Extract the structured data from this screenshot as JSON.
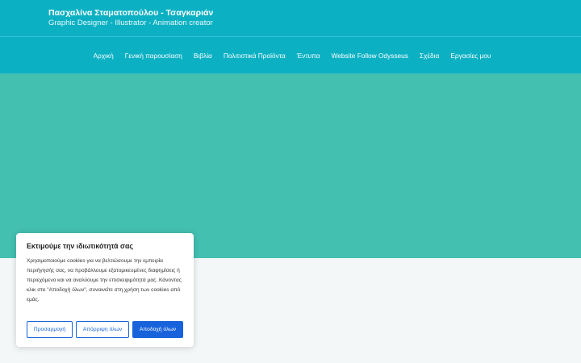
{
  "header": {
    "title": "Πασχαλίνα Σταματοπούλου - Τσαγκαριάν",
    "tagline": "Graphic Designer - Illustrator - Animation creator"
  },
  "nav": {
    "items": [
      {
        "label": "Αρχική"
      },
      {
        "label": "Γενική παρουσίαση"
      },
      {
        "label": "Βιβλία"
      },
      {
        "label": "Πολιτιστικά Προϊόντα"
      },
      {
        "label": "Έντυπα"
      },
      {
        "label": "Website Follow Odysseus"
      },
      {
        "label": "Σχέδια"
      },
      {
        "label": "Εργασίες μου"
      }
    ]
  },
  "cookie_banner": {
    "title": "Εκτιμούμε την ιδιωτικότητά σας",
    "text": "Χρησιμοποιούμε cookies για να βελτιώσουμε την εμπειρία περιήγησής σας, να προβάλλουμε εξατομικευμένες διαφημίσεις ή περιεχόμενο και να αναλύουμε την επισκεψιμότητά μας. Κάνοντας κλικ στο \"Αποδοχή όλων\", συναινείτε στη χρήση των cookies από εμάς.",
    "customize_label": "Προσαρμογή",
    "reject_label": "Απόρριψη όλων",
    "accept_label": "Αποδοχή όλων"
  },
  "colors": {
    "header_bg": "#0bb0c3",
    "hero_bg": "#43c0b0",
    "page_bg": "#f3f7f8",
    "button_accent": "#1863dc"
  }
}
